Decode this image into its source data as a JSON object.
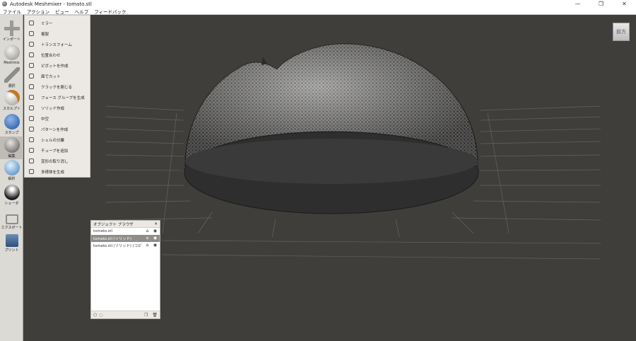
{
  "window": {
    "title": "Autodesk Meshmixer - tomato.stl",
    "controls": {
      "minimize": "—",
      "maximize": "❐",
      "close": "✕"
    }
  },
  "menubar": [
    "ファイル",
    "アクション",
    "ビュー",
    "ヘルプ",
    "フィードバック"
  ],
  "toolbar": [
    {
      "name": "import",
      "label": "インポート",
      "icon": "plus-icon"
    },
    {
      "name": "meshmix",
      "label": "Meshmix",
      "icon": "meshmix-sphere-icon"
    },
    {
      "name": "select",
      "label": "選択",
      "icon": "arrow-cursor-icon"
    },
    {
      "name": "sculpt",
      "label": "スカルプト",
      "icon": "brush-icon"
    },
    {
      "name": "stamp",
      "label": "スタンプ",
      "icon": "stamp-icon"
    },
    {
      "name": "edit",
      "label": "編集",
      "icon": "edit-sphere-icon",
      "active": true
    },
    {
      "name": "analysis",
      "label": "解析",
      "icon": "analysis-sphere-icon"
    },
    {
      "name": "shaders",
      "label": "シェーダ",
      "icon": "shader-sphere-icon"
    },
    {
      "name": "export",
      "label": "エクスポート",
      "icon": "export-icon"
    },
    {
      "name": "print",
      "label": "プリント",
      "icon": "printer-icon"
    }
  ],
  "edit_menu": [
    {
      "label": "ミラー",
      "icon": "mirror-icon"
    },
    {
      "label": "複製",
      "icon": "duplicate-icon"
    },
    {
      "label": "トランスフォーム",
      "icon": "transform-icon"
    },
    {
      "label": "位置合わせ",
      "icon": "align-icon"
    },
    {
      "label": "ピボットを作成",
      "icon": "pivot-icon"
    },
    {
      "label": "面でカット",
      "icon": "plane-cut-icon"
    },
    {
      "label": "クラックを閉じる",
      "icon": "close-cracks-icon"
    },
    {
      "label": "フェース グループを生成",
      "icon": "face-groups-icon"
    },
    {
      "label": "ソリッド作成",
      "icon": "make-solid-icon"
    },
    {
      "label": "中空",
      "icon": "hollow-icon"
    },
    {
      "label": "パターンを作成",
      "icon": "pattern-icon"
    },
    {
      "label": "シェルの分離",
      "icon": "separate-shells-icon"
    },
    {
      "label": "チューブを追加",
      "icon": "add-tube-icon"
    },
    {
      "label": "変形の取り消し",
      "icon": "replace-icon"
    },
    {
      "label": "多様体を生成",
      "icon": "manifold-icon"
    }
  ],
  "viewcube": {
    "label": "前方"
  },
  "object_browser": {
    "title": "オブジェクト ブラウザ",
    "close": "✕",
    "rows": [
      {
        "name": "tomato.stl",
        "selected": false
      },
      {
        "name": "tomato.stl (ソリッド)",
        "selected": true
      },
      {
        "name": "tomato.stl (ソリッド) (コピー)",
        "selected": false
      }
    ]
  },
  "colors": {
    "background": "#3f3e3b",
    "grid": "#6e6d69",
    "mesh": "#1c1c1c",
    "toolbar": "#dcdad5"
  }
}
